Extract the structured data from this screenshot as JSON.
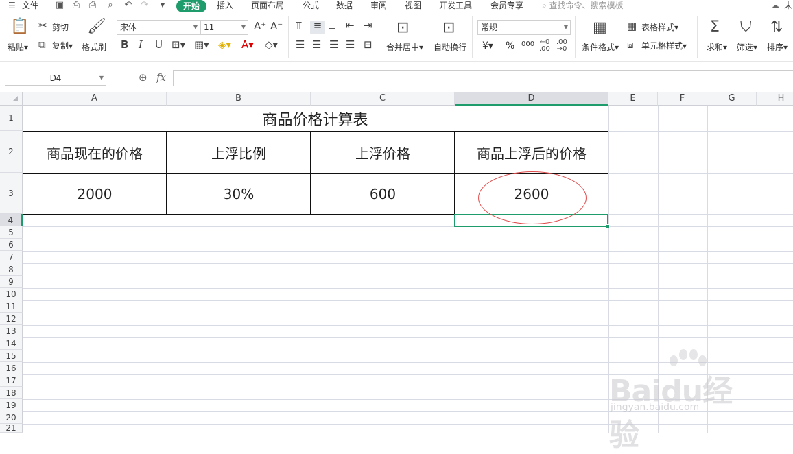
{
  "menubar": {
    "file": "文件",
    "tabs": [
      "开始",
      "插入",
      "页面布局",
      "公式",
      "数据",
      "审阅",
      "视图",
      "开发工具",
      "会员专享"
    ],
    "search_placeholder": "查找命令、搜索模板",
    "right_text": "未"
  },
  "ribbon": {
    "paste": "粘贴",
    "cut": "剪切",
    "copy": "复制",
    "format_painter": "格式刷",
    "font_name": "宋体",
    "font_size": "11",
    "merge_center": "合并居中",
    "wrap_text": "自动换行",
    "number_format": "常规",
    "currency": "¥",
    "percent": "%",
    "thousands": "000",
    "conditional_format": "条件格式",
    "table_style": "表格样式",
    "cell_style": "单元格样式",
    "sum": "求和",
    "filter": "筛选",
    "sort": "排序"
  },
  "formula_bar": {
    "name_box": "D4",
    "fx": "fx",
    "value": ""
  },
  "grid": {
    "columns": [
      "A",
      "B",
      "C",
      "D",
      "E",
      "F",
      "G",
      "H"
    ],
    "selected_column": "D",
    "rows": [
      "1",
      "2",
      "3",
      "4",
      "5",
      "6",
      "7",
      "8",
      "9",
      "10",
      "11",
      "12",
      "13",
      "14",
      "15",
      "16",
      "17",
      "18",
      "19",
      "20",
      "21"
    ],
    "selected_row": "4"
  },
  "sheet": {
    "title": "商品价格计算表",
    "headers": [
      "商品现在的价格",
      "上浮比例",
      "上浮价格",
      "商品上浮后的价格"
    ],
    "values": [
      "2000",
      "30%",
      "600",
      "2600"
    ]
  },
  "watermark": {
    "brand": "Baidu经验",
    "url": "jingyan.baidu.com"
  },
  "colors": {
    "accent": "#1f9c6b",
    "annotation_circle": "#e04a4a"
  }
}
